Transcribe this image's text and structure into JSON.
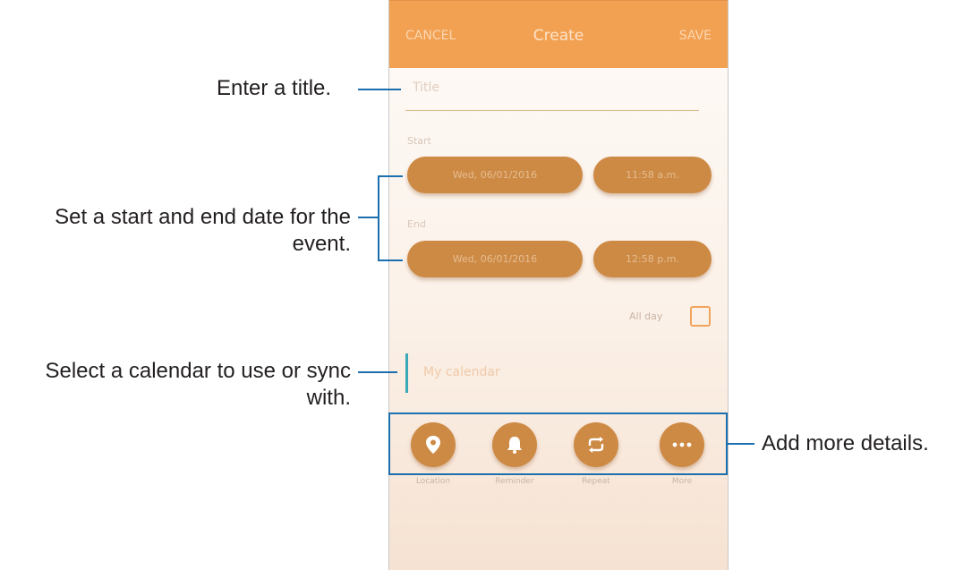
{
  "appbar": {
    "cancel": "CANCEL",
    "title": "Create",
    "save": "SAVE"
  },
  "form": {
    "title_placeholder": "Title",
    "start_label": "Start",
    "start_date": "Wed, 06/01/2016",
    "start_time": "11:58 a.m.",
    "end_label": "End",
    "end_date": "Wed, 06/01/2016",
    "end_time": "12:58 p.m.",
    "all_day_label": "All day",
    "calendar": "My calendar"
  },
  "details": [
    {
      "label": "Location",
      "icon": "location-pin-icon"
    },
    {
      "label": "Reminder",
      "icon": "bell-icon"
    },
    {
      "label": "Repeat",
      "icon": "repeat-icon"
    },
    {
      "label": "More",
      "icon": "more-dots-icon"
    }
  ],
  "callouts": {
    "title": "Enter a title.",
    "dates_line1": "Set a start and end date for the",
    "dates_line2": "event.",
    "calendar_line1": "Select a calendar to use or sync",
    "calendar_line2": "with.",
    "details": "Add more details."
  },
  "colors": {
    "appbar": "#f2a152",
    "pill": "#cd8a45",
    "callout_line": "#1b6fae",
    "calendar_accent": "#3aa8b8"
  }
}
